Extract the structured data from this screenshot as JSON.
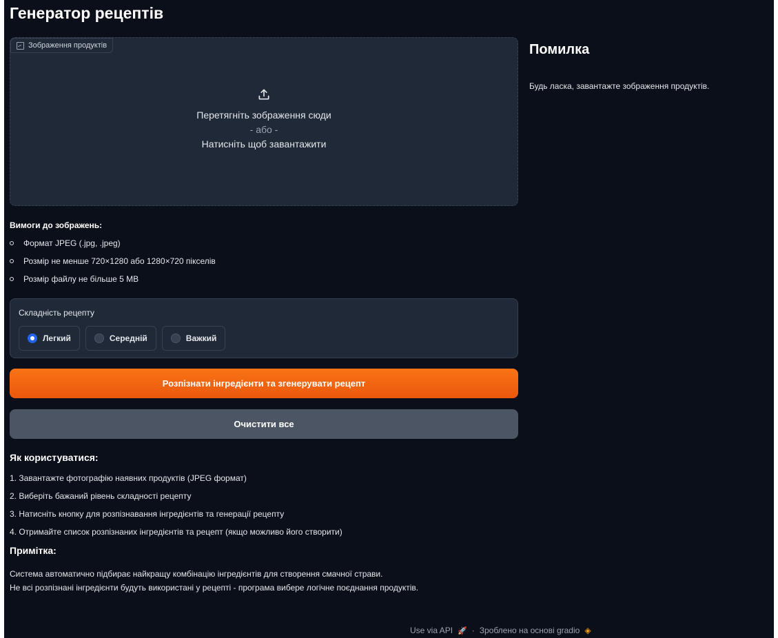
{
  "app": {
    "title": "Генератор рецептів"
  },
  "upload": {
    "label": "Зображення продуктів",
    "drop_text": "Перетягніть зображення сюди",
    "or_text": "- або -",
    "click_text": "Натисніть щоб завантажити"
  },
  "requirements": {
    "title": "Вимоги до зображень:",
    "items": [
      "Формат JPEG (.jpg, .jpeg)",
      "Розмір не менше 720×1280 або 1280×720 пікселів",
      "Розмір файлу не більше 5 MB"
    ]
  },
  "difficulty": {
    "label": "Складність рецепту",
    "options": [
      "Легкий",
      "Середній",
      "Важкий"
    ],
    "selected": "Легкий"
  },
  "buttons": {
    "submit": "Розпізнати інгредієнти та згенерувати рецепт",
    "clear": "Очистити все"
  },
  "howto": {
    "title": "Як користуватися:",
    "steps": [
      "1. Завантажте фотографію наявних продуктів (JPEG формат)",
      "2. Виберіть бажаний рівень складності рецепту",
      "3. Натисніть кнопку для розпізнавання інгредієнтів та генерації рецепту",
      "4. Отримайте список розпізнаних інгредієнтів та рецепт (якщо можливо його створити)"
    ]
  },
  "note": {
    "title": "Примітка:",
    "lines": [
      "Система автоматично підбирає найкращу комбінацію інгредієнтів для створення смачної страви.",
      "Не всі розпізнані інгредієнти будуть використані у рецепті - програма вибере логічне поєднання продуктів."
    ]
  },
  "output": {
    "title": "Помилка",
    "message": "Будь ласка, завантажте зображення продуктів."
  },
  "footer": {
    "api_link": "Use via API",
    "separator": "·",
    "built_with": "Зроблено на основі gradio"
  },
  "colors": {
    "background": "#0b0f19",
    "panel": "#1f2937",
    "accent": "#f97316",
    "radio_selected": "#2563eb"
  }
}
